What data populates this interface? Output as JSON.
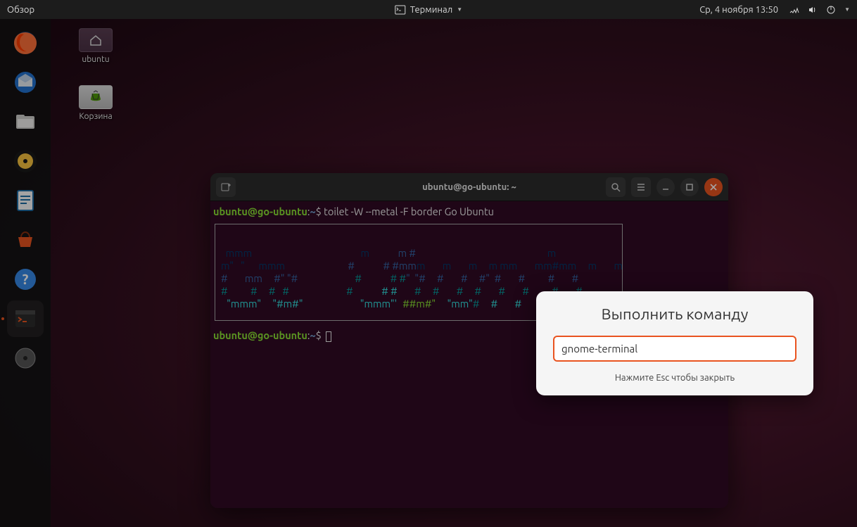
{
  "topbar": {
    "overview": "Обзор",
    "app_name": "Терминал",
    "datetime": "Ср, 4 ноября  13:50"
  },
  "desktop": {
    "home_label": "ubuntu",
    "trash_label": "Корзина"
  },
  "dock": {
    "items": [
      {
        "name": "firefox"
      },
      {
        "name": "thunderbird"
      },
      {
        "name": "files"
      },
      {
        "name": "rhythmbox"
      },
      {
        "name": "libreoffice-writer"
      },
      {
        "name": "software"
      },
      {
        "name": "help"
      },
      {
        "name": "terminal"
      },
      {
        "name": "disc"
      }
    ]
  },
  "terminal": {
    "title": "ubuntu@go-ubuntu: ~",
    "prompt_user": "ubuntu@go-ubuntu",
    "prompt_path": "~",
    "command": "toilet -W --metal -F border Go Ubuntu",
    "ascii_text": "Go Ubuntu"
  },
  "run_dialog": {
    "title": "Выполнить команду",
    "value": "gnome-terminal",
    "hint": "Нажмите Esc чтобы закрыть"
  }
}
